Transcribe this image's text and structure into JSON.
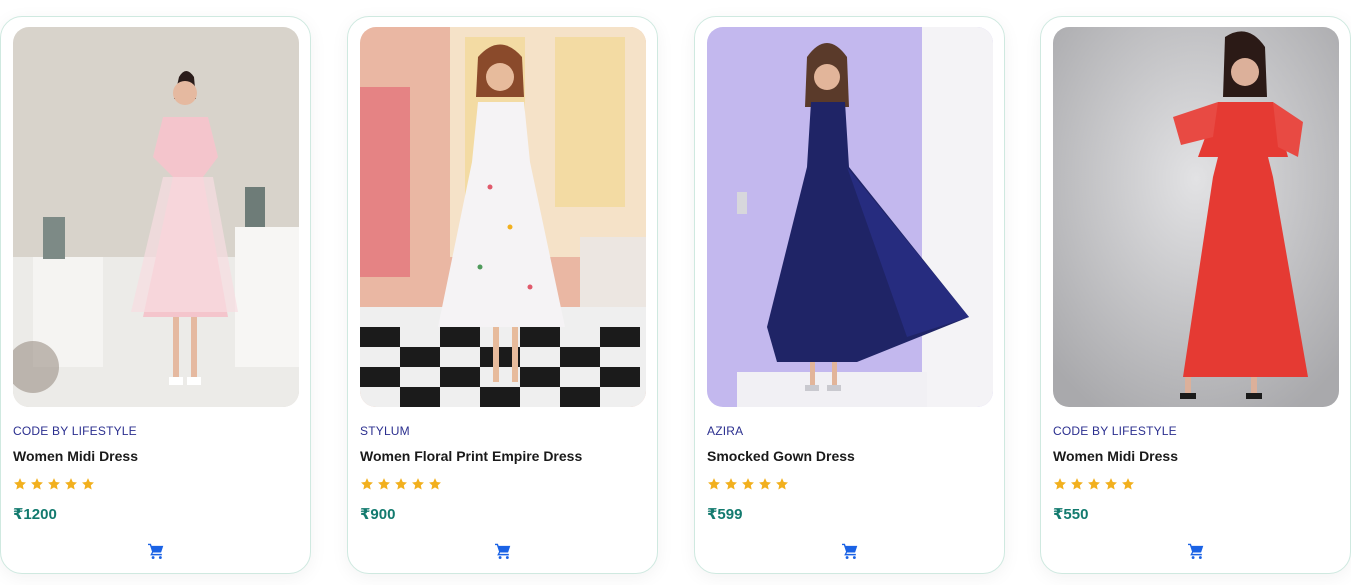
{
  "products": [
    {
      "brand": "CODE BY LIFESTYLE",
      "title": "Women Midi Dress",
      "rating": 5,
      "price": "₹1200",
      "image_icon": "floral-midi-dress-photo",
      "dress_color": "#f4c5cc",
      "bg_color": "#d9d4cc"
    },
    {
      "brand": "STYLUM",
      "title": "Women Floral Print Empire Dress",
      "rating": 5,
      "price": "₹900",
      "image_icon": "white-floral-empire-dress-photo",
      "dress_color": "#f5f3f5",
      "bg_color": "#e9b9a6"
    },
    {
      "brand": "AZIRA",
      "title": "Smocked Gown Dress",
      "rating": 5,
      "price": "₹599",
      "image_icon": "navy-gown-dress-photo",
      "dress_color": "#1f2466",
      "bg_color": "#c5b9ef"
    },
    {
      "brand": "CODE BY LIFESTYLE",
      "title": "Women Midi Dress",
      "rating": 5,
      "price": "₹550",
      "image_icon": "red-midi-dress-photo",
      "dress_color": "#e53a33",
      "bg_color": "#c9c9cb"
    }
  ],
  "colors": {
    "star": "#f2b01e",
    "cart": "#1a62e5",
    "price": "#127a6e",
    "brand": "#2b2f8f",
    "card_border": "#cfe9e0"
  }
}
